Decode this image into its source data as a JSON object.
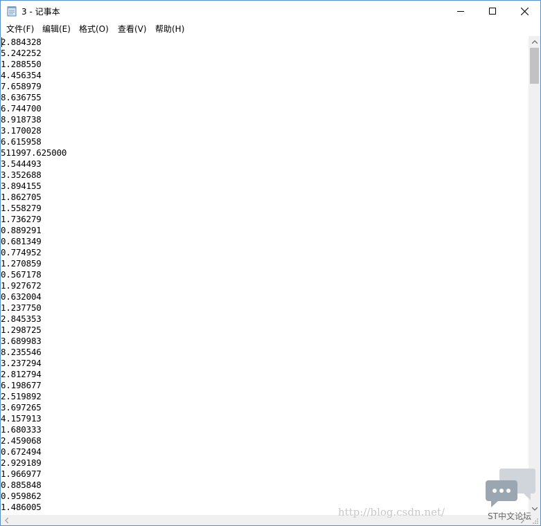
{
  "window": {
    "title": "3 - 记事本"
  },
  "menu": {
    "file": "文件(F)",
    "edit": "编辑(E)",
    "format": "格式(O)",
    "view": "查看(V)",
    "help": "帮助(H)"
  },
  "editor": {
    "lines": [
      "2.884328",
      "5.242252",
      "1.288550",
      "4.456354",
      "7.658979",
      "8.636755",
      "6.744700",
      "8.918738",
      "3.170028",
      "6.615958",
      "511997.625000",
      "3.544493",
      "3.352688",
      "3.894155",
      "1.862705",
      "1.558279",
      "1.736279",
      "0.889291",
      "0.681349",
      "0.774952",
      "1.270859",
      "0.567178",
      "1.927672",
      "0.632004",
      "1.237750",
      "2.845353",
      "1.298725",
      "3.689983",
      "8.235546",
      "3.237294",
      "2.812794",
      "6.198677",
      "2.519892",
      "3.697265",
      "4.157913",
      "1.680333",
      "2.459068",
      "0.672494",
      "2.929189",
      "1.966977",
      "0.885848",
      "0.959862",
      "1.486005"
    ]
  },
  "overlay": {
    "watermark": "http://blog.csdn.net/",
    "ime_status": "ST中文论坛"
  }
}
